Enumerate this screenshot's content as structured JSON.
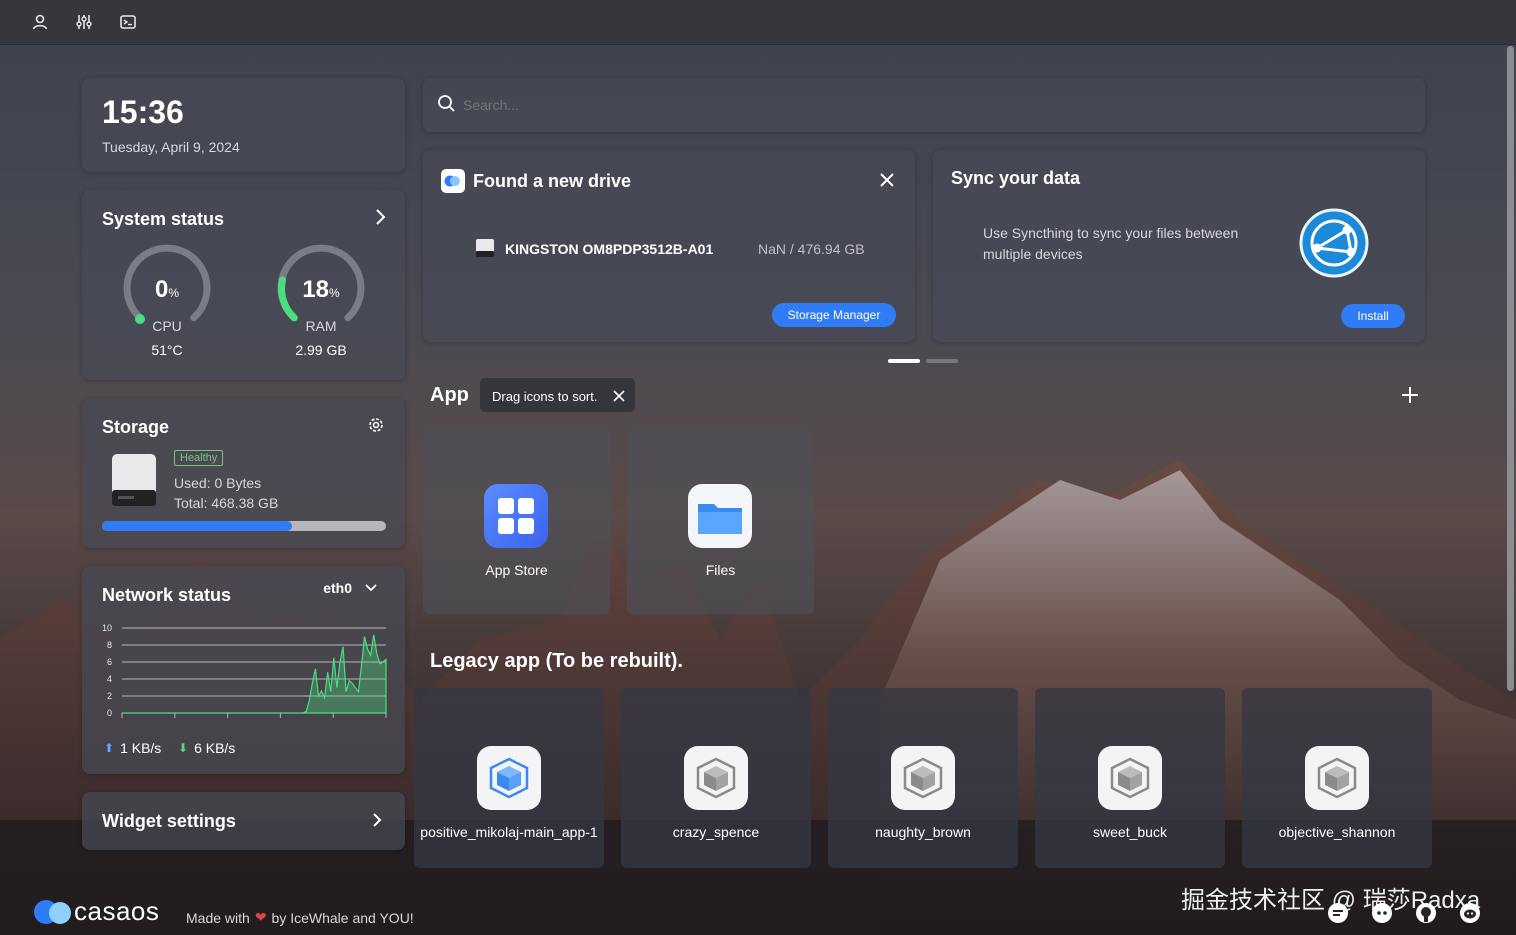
{
  "clock": {
    "time": "15:36",
    "date": "Tuesday, April 9, 2024"
  },
  "search": {
    "placeholder": "Search..."
  },
  "system_status": {
    "title": "System status",
    "cpu": {
      "value": "0",
      "unit": "%",
      "label": "CPU",
      "detail": "51°C",
      "fraction": 0.0
    },
    "ram": {
      "value": "18",
      "unit": "%",
      "label": "RAM",
      "detail": "2.99 GB",
      "fraction": 0.18
    }
  },
  "storage": {
    "title": "Storage",
    "badge": "Healthy",
    "used": "Used: 0 Bytes",
    "total": "Total: 468.38 GB",
    "bar_fraction": 0.67
  },
  "network": {
    "title": "Network status",
    "interface": "eth0",
    "upload": "1 KB/s",
    "download": "6 KB/s",
    "y_ticks": [
      "10",
      "8",
      "6",
      "4",
      "2",
      "0"
    ]
  },
  "widget_settings": {
    "label": "Widget settings"
  },
  "new_drive": {
    "title": "Found a new drive",
    "drive_name": "KINGSTON OM8PDP3512B-A01",
    "drive_size": "NaN / 476.94 GB",
    "button": "Storage Manager"
  },
  "sync": {
    "title": "Sync your data",
    "description_line1": "Use Syncthing to sync your files between",
    "description_line2": "multiple devices",
    "button": "Install"
  },
  "apps_section": {
    "title": "App",
    "tooltip": "Drag icons to sort."
  },
  "apps": [
    {
      "name": "App Store"
    },
    {
      "name": "Files"
    }
  ],
  "legacy_section": {
    "title": "Legacy app (To be rebuilt)."
  },
  "legacy_apps": [
    {
      "name": "positive_mikolaj-main_app-1"
    },
    {
      "name": "crazy_spence"
    },
    {
      "name": "naughty_brown"
    },
    {
      "name": "sweet_buck"
    },
    {
      "name": "objective_shannon"
    }
  ],
  "footer": {
    "brand": "casaos",
    "made_with": "Made with",
    "by": "by IceWhale and YOU!",
    "watermark": "掘金技术社区 @ 瑞莎Radxa"
  },
  "colors": {
    "accent": "#2f7cf6",
    "healthy": "#7bc47f",
    "ram_ring": "#4ade80"
  },
  "chart_data": {
    "type": "area",
    "title": "",
    "ylim": [
      0,
      10
    ],
    "yticks": [
      0,
      2,
      4,
      6,
      8,
      10
    ],
    "series": [
      {
        "values": [
          0,
          0,
          0,
          0,
          0,
          0,
          0,
          0,
          0,
          0,
          0,
          0,
          0,
          0,
          0,
          0,
          0,
          0,
          0,
          0,
          0,
          0,
          0,
          0,
          0,
          0,
          0,
          0,
          0,
          0,
          0,
          0,
          0,
          0,
          0,
          0,
          0,
          0,
          0,
          0,
          0,
          0,
          0,
          0,
          0,
          0,
          0,
          0,
          0,
          0,
          0,
          0,
          0,
          0,
          0,
          0,
          0,
          0,
          0,
          0,
          0.2,
          1.5,
          3.5,
          5.2,
          2.0,
          2.6,
          1.8,
          4.8,
          2.5,
          6.5,
          3.0,
          6.0,
          7.8,
          2.5,
          3.8,
          3.5,
          3.0,
          2.5,
          5.5,
          9.0,
          7.5,
          6.8,
          9.2,
          7.0,
          5.8,
          6.0,
          6.3
        ]
      }
    ]
  }
}
